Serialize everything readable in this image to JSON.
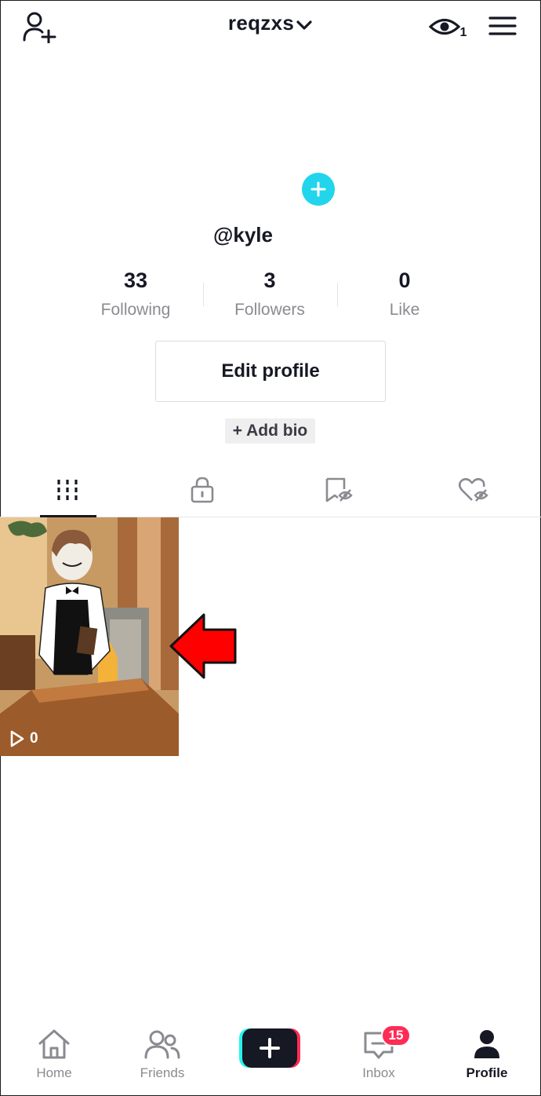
{
  "header": {
    "account_name": "reqzxs",
    "viewers_count": "1",
    "icons": [
      "add-friend-icon",
      "chevron-down-icon",
      "eye-icon",
      "menu-icon"
    ]
  },
  "profile": {
    "handle": "@kyle",
    "stats": [
      {
        "value": "33",
        "label": "Following"
      },
      {
        "value": "3",
        "label": "Followers"
      },
      {
        "value": "0",
        "label": "Like"
      }
    ],
    "edit_button": "Edit profile",
    "add_bio": "+ Add bio"
  },
  "tabs": [
    {
      "icon": "grid-icon",
      "active": true
    },
    {
      "icon": "lock-icon",
      "active": false
    },
    {
      "icon": "hidden-bookmark-icon",
      "active": false
    },
    {
      "icon": "hidden-heart-icon",
      "active": false
    }
  ],
  "videos": [
    {
      "views": "0"
    }
  ],
  "nav": {
    "items": [
      {
        "label": "Home",
        "icon": "home-icon"
      },
      {
        "label": "Friends",
        "icon": "friends-icon"
      },
      {
        "label": "",
        "icon": "plus-icon"
      },
      {
        "label": "Inbox",
        "icon": "inbox-icon",
        "badge": "15"
      },
      {
        "label": "Profile",
        "icon": "profile-icon",
        "active": true
      }
    ]
  },
  "colors": {
    "accent_cyan": "#20d5ec",
    "accent_red": "#fe2c55",
    "annotation_arrow": "#ff0000"
  }
}
